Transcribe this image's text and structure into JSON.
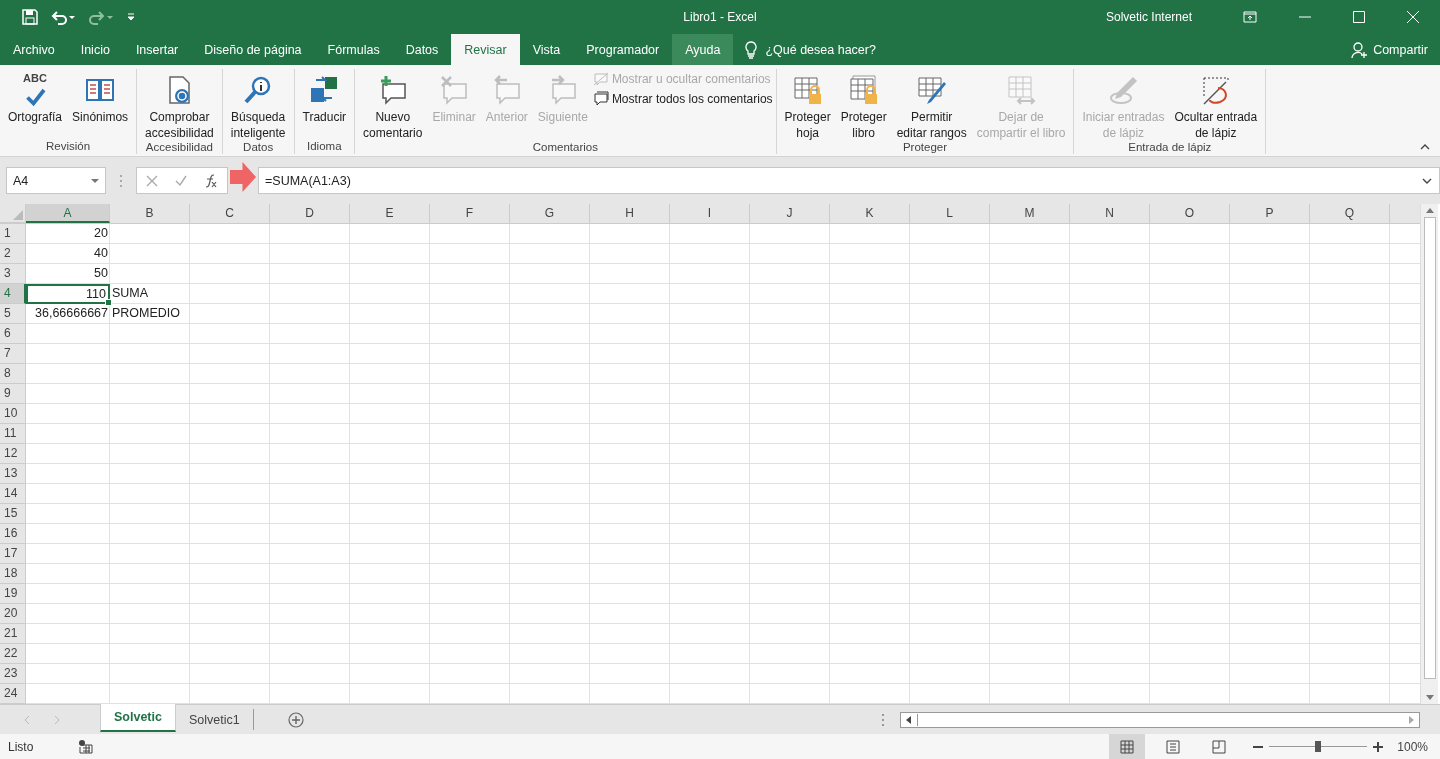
{
  "title_bar": {
    "title": "Libro1 - Excel",
    "user": "Solvetic Internet"
  },
  "tabs": [
    {
      "label": "Archivo",
      "selected": false,
      "hovered": false
    },
    {
      "label": "Inicio",
      "selected": false,
      "hovered": false
    },
    {
      "label": "Insertar",
      "selected": false,
      "hovered": false
    },
    {
      "label": "Diseño de página",
      "selected": false,
      "hovered": false
    },
    {
      "label": "Fórmulas",
      "selected": false,
      "hovered": false
    },
    {
      "label": "Datos",
      "selected": false,
      "hovered": false
    },
    {
      "label": "Revisar",
      "selected": true,
      "hovered": false
    },
    {
      "label": "Vista",
      "selected": false,
      "hovered": false
    },
    {
      "label": "Programador",
      "selected": false,
      "hovered": false
    },
    {
      "label": "Ayuda",
      "selected": false,
      "hovered": true
    }
  ],
  "tell_me": {
    "placeholder": "¿Qué desea hacer?"
  },
  "share": "Compartir",
  "ribbon": {
    "groups": [
      {
        "label": "Revisión",
        "buttons": [
          {
            "kind": "spelling",
            "icon_text": "ABC",
            "lines": [
              "Ortografía"
            ],
            "disabled": false
          },
          {
            "kind": "thesaurus",
            "lines": [
              "Sinónimos"
            ],
            "disabled": false
          }
        ]
      },
      {
        "label": "Accesibilidad",
        "buttons": [
          {
            "kind": "accessibility",
            "lines": [
              "Comprobar",
              "accesibilidad"
            ],
            "disabled": false
          }
        ]
      },
      {
        "label": "Datos",
        "buttons": [
          {
            "kind": "smart-lookup",
            "lines": [
              "Búsqueda",
              "inteligente"
            ],
            "disabled": false
          }
        ]
      },
      {
        "label": "Idioma",
        "buttons": [
          {
            "kind": "translate",
            "lines": [
              "Traducir"
            ],
            "disabled": false
          }
        ]
      },
      {
        "label": "Comentarios",
        "buttons": [
          {
            "kind": "new-comment",
            "lines": [
              "Nuevo",
              "comentario"
            ],
            "disabled": false
          },
          {
            "kind": "delete-comment",
            "lines": [
              "Eliminar"
            ],
            "disabled": true
          },
          {
            "kind": "previous-comment",
            "lines": [
              "Anterior"
            ],
            "disabled": true
          },
          {
            "kind": "next-comment",
            "lines": [
              "Siguiente"
            ],
            "disabled": true
          }
        ],
        "small": [
          {
            "kind": "toggle-comment",
            "label": "Mostrar u ocultar comentarios",
            "disabled": true
          },
          {
            "kind": "all-comments",
            "label": "Mostrar todos los comentarios",
            "disabled": false
          }
        ]
      },
      {
        "label": "Proteger",
        "buttons": [
          {
            "kind": "protect-sheet",
            "lines": [
              "Proteger",
              "hoja"
            ],
            "disabled": false
          },
          {
            "kind": "protect-book",
            "lines": [
              "Proteger",
              "libro"
            ],
            "disabled": false
          },
          {
            "kind": "allow-edit",
            "lines": [
              "Permitir",
              "editar rangos"
            ],
            "disabled": false
          },
          {
            "kind": "unshare",
            "lines": [
              "Dejar de",
              "compartir el libro"
            ],
            "disabled": true
          }
        ]
      },
      {
        "label": "Entrada de lápiz",
        "buttons": [
          {
            "kind": "start-ink",
            "lines": [
              "Iniciar entradas",
              "de lápiz"
            ],
            "disabled": true
          },
          {
            "kind": "hide-ink",
            "lines": [
              "Ocultar entrada",
              "de lápiz"
            ],
            "disabled": false
          }
        ]
      }
    ]
  },
  "formula_bar": {
    "name_box": "A4",
    "formula": "=SUMA(A1:A3)"
  },
  "columns": [
    {
      "label": "A",
      "selected": true
    },
    {
      "label": "B",
      "selected": false
    },
    {
      "label": "C",
      "selected": false
    },
    {
      "label": "D",
      "selected": false
    },
    {
      "label": "E",
      "selected": false
    },
    {
      "label": "F",
      "selected": false
    },
    {
      "label": "G",
      "selected": false
    },
    {
      "label": "H",
      "selected": false
    },
    {
      "label": "I",
      "selected": false
    },
    {
      "label": "J",
      "selected": false
    },
    {
      "label": "K",
      "selected": false
    },
    {
      "label": "L",
      "selected": false
    },
    {
      "label": "M",
      "selected": false
    },
    {
      "label": "N",
      "selected": false
    },
    {
      "label": "O",
      "selected": false
    },
    {
      "label": "P",
      "selected": false
    },
    {
      "label": "Q",
      "selected": false
    }
  ],
  "rows": [
    {
      "label": "1",
      "selected": false,
      "cells": [
        {
          "text": "20",
          "kind": "number",
          "selected": false
        }
      ]
    },
    {
      "label": "2",
      "selected": false,
      "cells": [
        {
          "text": "40",
          "kind": "number",
          "selected": false
        }
      ]
    },
    {
      "label": "3",
      "selected": false,
      "cells": [
        {
          "text": "50",
          "kind": "number",
          "selected": false
        }
      ]
    },
    {
      "label": "4",
      "selected": true,
      "cells": [
        {
          "text": "110",
          "kind": "number",
          "selected": true
        },
        {
          "text": "SUMA",
          "kind": "text",
          "selected": false
        }
      ]
    },
    {
      "label": "5",
      "selected": false,
      "cells": [
        {
          "text": "36,66666667",
          "kind": "number",
          "selected": false
        },
        {
          "text": "PROMEDIO",
          "kind": "text",
          "selected": false
        }
      ]
    },
    {
      "label": "6",
      "selected": false
    },
    {
      "label": "7",
      "selected": false
    },
    {
      "label": "8",
      "selected": false
    },
    {
      "label": "9",
      "selected": false
    },
    {
      "label": "10",
      "selected": false
    },
    {
      "label": "11",
      "selected": false
    },
    {
      "label": "12",
      "selected": false
    },
    {
      "label": "13",
      "selected": false
    },
    {
      "label": "14",
      "selected": false
    },
    {
      "label": "15",
      "selected": false
    },
    {
      "label": "16",
      "selected": false
    },
    {
      "label": "17",
      "selected": false
    },
    {
      "label": "18",
      "selected": false
    },
    {
      "label": "19",
      "selected": false
    },
    {
      "label": "20",
      "selected": false
    },
    {
      "label": "21",
      "selected": false
    },
    {
      "label": "22",
      "selected": false
    },
    {
      "label": "23",
      "selected": false
    },
    {
      "label": "24",
      "selected": false
    }
  ],
  "sheet_tabs": [
    {
      "label": "Solvetic",
      "selected": true
    },
    {
      "label": "Solvetic1",
      "selected": false
    }
  ],
  "status_bar": {
    "status": "Listo",
    "views": [
      {
        "kind": "normal",
        "selected": true
      },
      {
        "kind": "page-layout",
        "selected": false
      },
      {
        "kind": "page-break",
        "selected": false
      }
    ],
    "zoom": {
      "level": 0.5,
      "reading": "100%"
    }
  }
}
